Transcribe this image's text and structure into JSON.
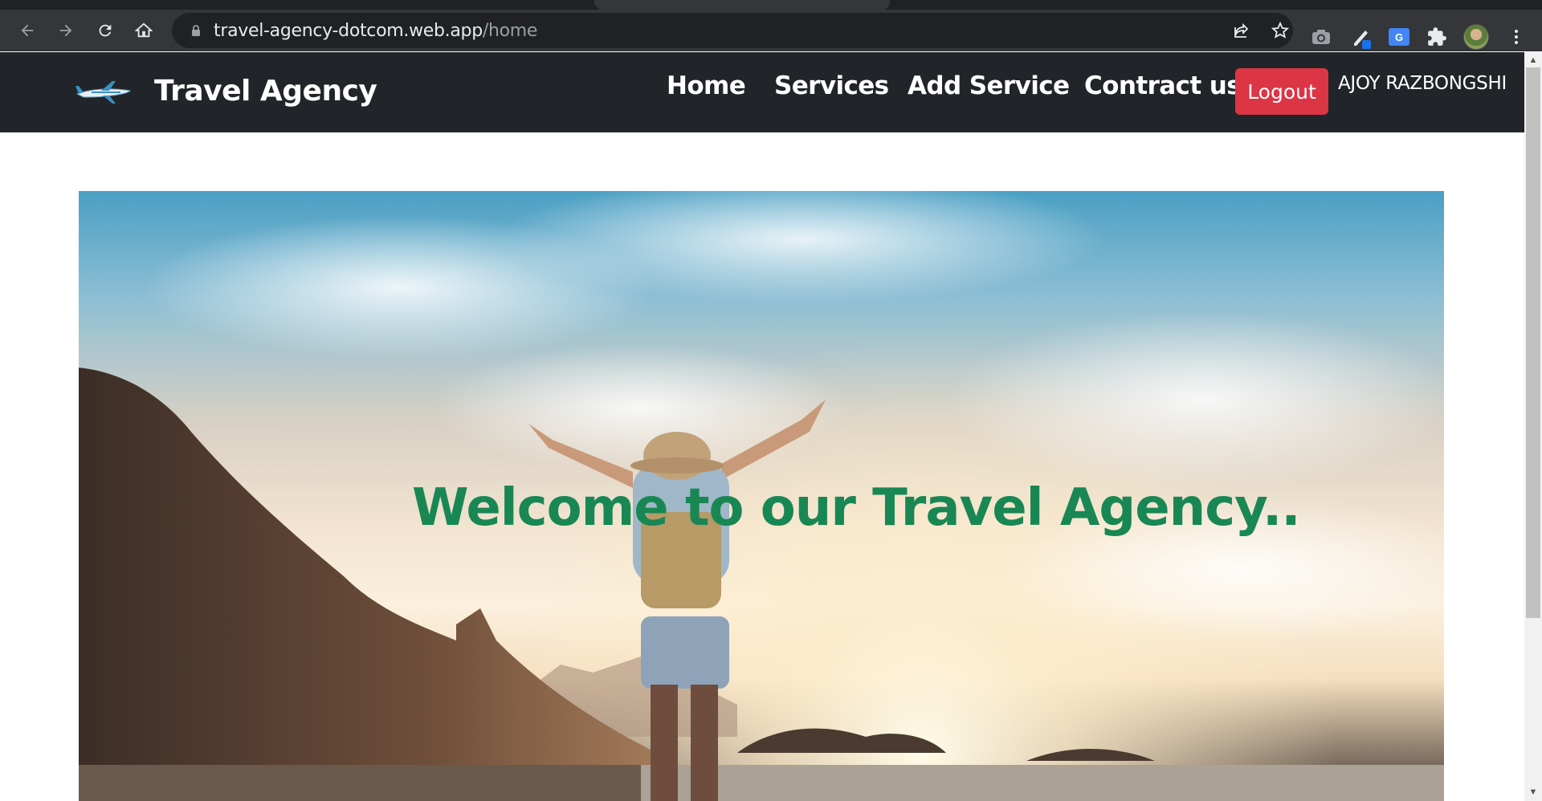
{
  "browser": {
    "url_host": "travel-agency-dotcom.web.app",
    "url_path": "/home",
    "icons": [
      "back-arrow-icon",
      "forward-arrow-icon",
      "reload-icon",
      "home-icon",
      "lock-icon",
      "share-icon",
      "star-icon",
      "camera-extension-icon",
      "pen-extension-icon",
      "google-translate-icon",
      "puzzle-extensions-icon",
      "profile-avatar",
      "kebab-menu-icon"
    ],
    "translate_label": "G"
  },
  "navbar": {
    "brand": "Travel Agency",
    "links": [
      "Home",
      "Services",
      "Add Service",
      "Contract us"
    ],
    "logout_label": "Logout",
    "user_name": "AJOY RAZBONGSHI",
    "colors": {
      "bg": "#212529",
      "logout": "#dc3545"
    }
  },
  "hero": {
    "title": "Welcome to our Travel Agency..",
    "title_color": "#198754",
    "image": "traveler-on-beach-at-sunset"
  }
}
